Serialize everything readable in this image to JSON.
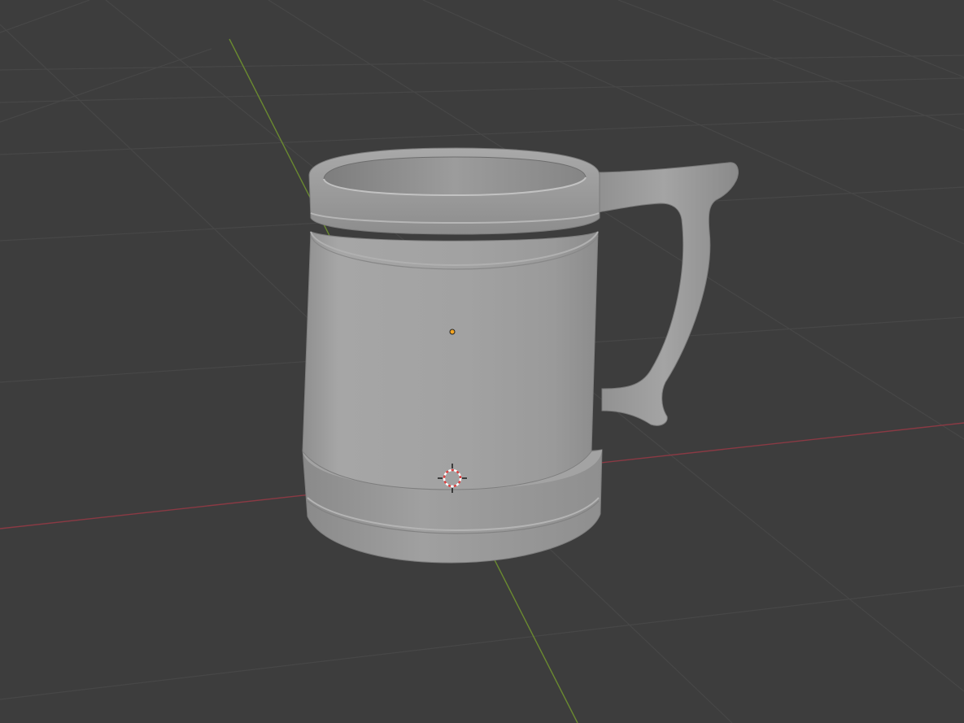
{
  "viewport": {
    "view": "3D Viewport",
    "shading": "solid",
    "selected_object": "mug",
    "colors": {
      "background": "#3d3d3d",
      "grid_line": "#4a4a4a",
      "x_axis": "#8a3a44",
      "y_axis": "#6a8a30",
      "object_origin": "#f5a623",
      "cursor_red": "#e04040",
      "cursor_white": "#ffffff",
      "mesh_base": "#9b9b9b"
    },
    "icons": {
      "origin": "object-origin-dot",
      "cursor": "3d-cursor-crosshair"
    }
  }
}
